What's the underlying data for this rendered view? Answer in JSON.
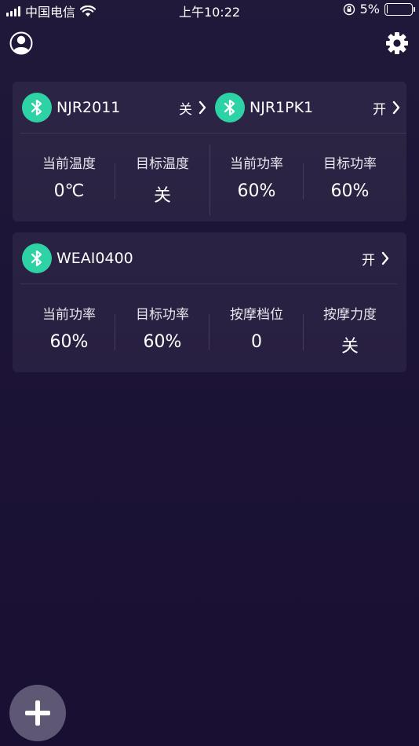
{
  "status_bar": {
    "carrier": "中国电信",
    "time": "上午10:22",
    "battery_percent": "5%",
    "battery_level": 0.05
  },
  "header": {
    "profile_icon": "user-icon",
    "settings_icon": "gear-icon"
  },
  "cards": [
    {
      "devices": [
        {
          "name": "NJR2011",
          "state": "关"
        },
        {
          "name": "NJR1PK1",
          "state": "开"
        }
      ],
      "stats": [
        {
          "label": "当前温度",
          "value": "0℃"
        },
        {
          "label": "目标温度",
          "value": "关"
        },
        {
          "label": "当前功率",
          "value": "60%"
        },
        {
          "label": "目标功率",
          "value": "60%"
        }
      ]
    },
    {
      "devices": [
        {
          "name": "WEAI0400",
          "state": "开"
        }
      ],
      "stats": [
        {
          "label": "当前功率",
          "value": "60%"
        },
        {
          "label": "目标功率",
          "value": "60%"
        },
        {
          "label": "按摩档位",
          "value": "0"
        },
        {
          "label": "按摩力度",
          "value": "关"
        }
      ]
    }
  ],
  "fab": {
    "icon": "plus-icon"
  },
  "colors": {
    "bluetooth_badge": "#2ed3a5",
    "background_top": "#21193a",
    "background_bottom": "#190f33",
    "fab": "#5e5875"
  }
}
